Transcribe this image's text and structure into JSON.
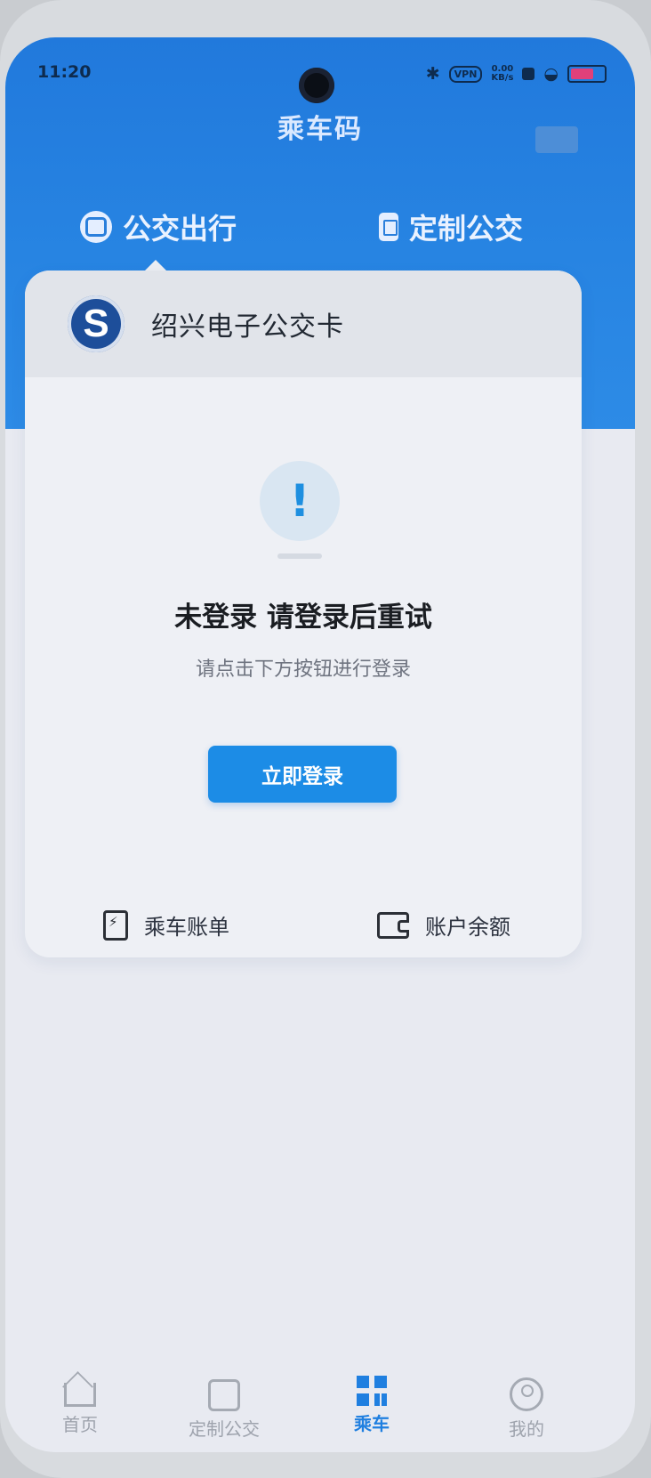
{
  "status_bar": {
    "time": "11:20",
    "vpn": "VPN",
    "net_speed": "0.00",
    "net_unit": "KB/s",
    "battery_fill": 0.72
  },
  "header": {
    "title": "乘车码"
  },
  "tabs": [
    {
      "label": "公交出行",
      "icon": "bus-icon",
      "active": true
    },
    {
      "label": "定制公交",
      "icon": "custom-bus-icon",
      "active": false
    }
  ],
  "card": {
    "title": "绍兴电子公交卡",
    "logo_letter": "S",
    "message_title": "未登录 请登录后重试",
    "message_sub": "请点击下方按钮进行登录",
    "login_button": "立即登录",
    "quick_actions": [
      {
        "label": "乘车账单",
        "icon": "bill-icon"
      },
      {
        "label": "账户余额",
        "icon": "wallet-icon"
      }
    ]
  },
  "tabbar": [
    {
      "label": "首页",
      "icon": "home-icon",
      "active": false
    },
    {
      "label": "定制公交",
      "icon": "bus-icon",
      "active": false
    },
    {
      "label": "乘车",
      "icon": "qr-code-icon",
      "active": true
    },
    {
      "label": "我的",
      "icon": "user-icon",
      "active": false
    }
  ],
  "colors": {
    "primary": "#1c8ce6",
    "header_blue": "#2179dc",
    "alert_blue": "#1e8fe0"
  }
}
